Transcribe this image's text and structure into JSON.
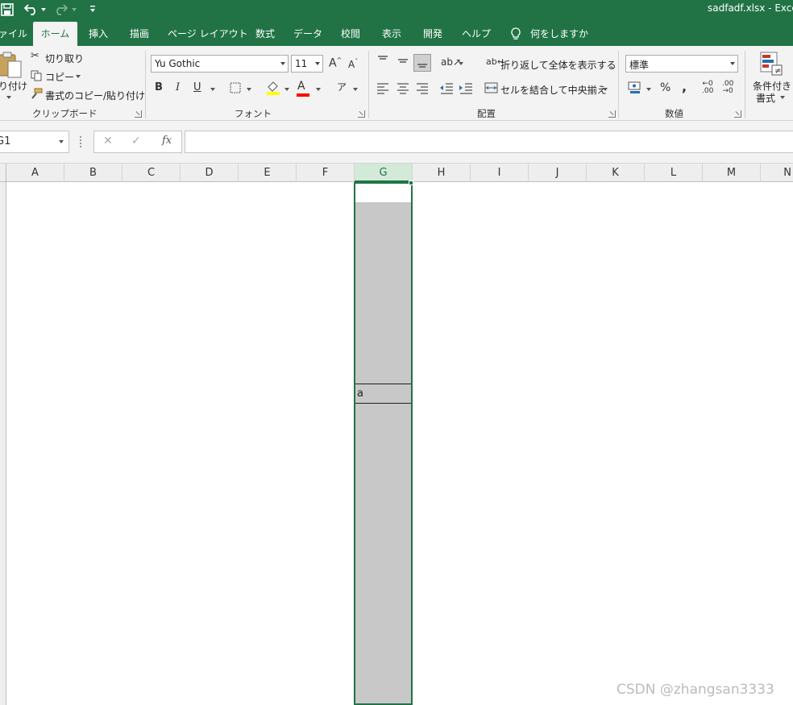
{
  "titlebar": {
    "title": "sadfadf.xlsx  -  Exce"
  },
  "tabs": [
    {
      "label": "ァイル"
    },
    {
      "label": "ホーム"
    },
    {
      "label": "挿入"
    },
    {
      "label": "描画"
    },
    {
      "label": "ページ レイアウト"
    },
    {
      "label": "数式"
    },
    {
      "label": "データ"
    },
    {
      "label": "校閲"
    },
    {
      "label": "表示"
    },
    {
      "label": "開発"
    },
    {
      "label": "ヘルプ"
    },
    {
      "label": "何をしますか"
    }
  ],
  "clipboard": {
    "paste_label": "り付け",
    "cut_label": "切り取り",
    "copy_label": "コピー",
    "format_painter_label": "書式のコピー/貼り付け",
    "group_label": "クリップボード"
  },
  "font": {
    "font_name": "Yu Gothic",
    "font_size": "11",
    "bold": "B",
    "italic": "I",
    "underline": "U",
    "grow": "A",
    "shrink": "A",
    "color_glyph": "A",
    "group_label": "フォント"
  },
  "alignment": {
    "wrap_label": "折り返して全体を表示する",
    "merge_label": "セルを結合して中央揃え",
    "group_label": "配置"
  },
  "number": {
    "format": "標準",
    "percent": "%",
    "comma": ",",
    "inc_decimal_top": "←0",
    "inc_decimal_bottom": ".00",
    "dec_decimal_top": ".00",
    "dec_decimal_bottom": "→0",
    "group_label": "数値"
  },
  "styles": {
    "conditional_label_1": "条件付き",
    "conditional_label_2": "書式"
  },
  "formula_bar": {
    "name_box": "G1",
    "fx": "fx",
    "formula": ""
  },
  "columns": [
    "A",
    "B",
    "C",
    "D",
    "E",
    "F",
    "G",
    "H",
    "I",
    "J",
    "K",
    "L",
    "M",
    "N"
  ],
  "selected_column": "G",
  "cell_value": "a",
  "watermark": "CSDN @zhangsan3333",
  "colors": {
    "excel_green": "#217346",
    "selection_fill": "#c8c8c8"
  }
}
